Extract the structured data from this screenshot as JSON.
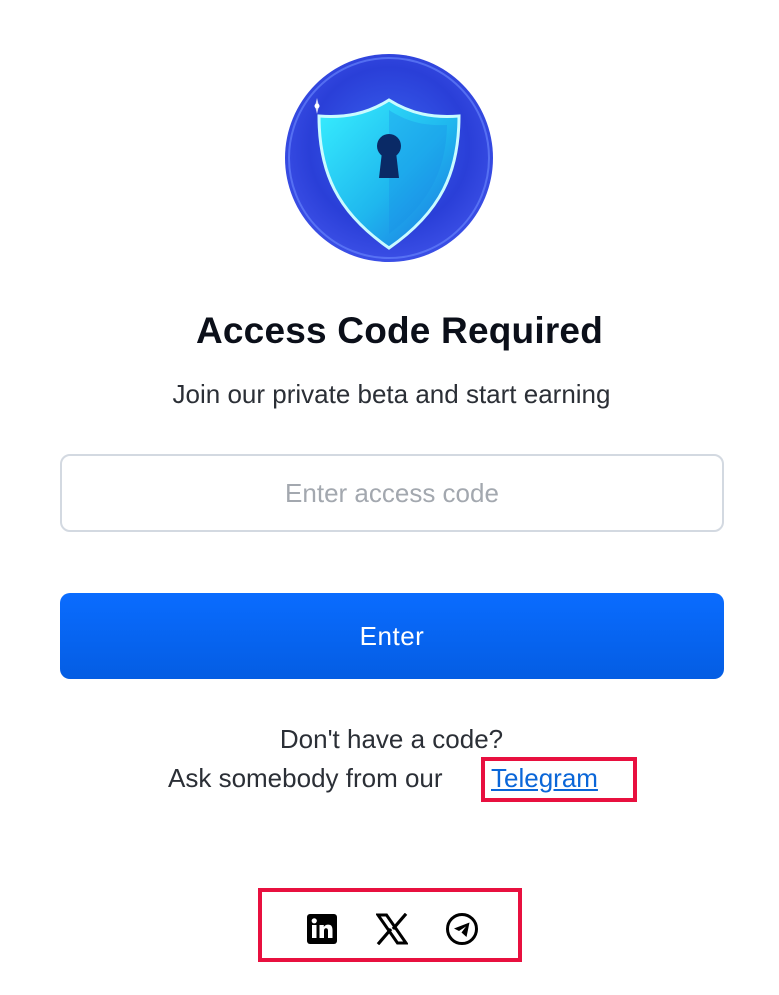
{
  "logo": {
    "icon": "shield-keyhole-icon"
  },
  "heading": {
    "title": "Access Code Required",
    "subtitle": "Join our private beta and start earning"
  },
  "form": {
    "access_code_value": "",
    "access_code_placeholder": "Enter access code",
    "submit_label": "Enter"
  },
  "help": {
    "question": "Don't have a code?",
    "ask_prefix": "Ask somebody from our",
    "telegram_link": "Telegram"
  },
  "social": {
    "items": [
      {
        "icon": "linkedin-icon"
      },
      {
        "icon": "x-icon"
      },
      {
        "icon": "telegram-icon"
      }
    ]
  },
  "colors": {
    "accent": "#0A6CFF",
    "link": "#0A66D8",
    "highlight": "#E8103F",
    "shield": "#2FD8F5"
  }
}
